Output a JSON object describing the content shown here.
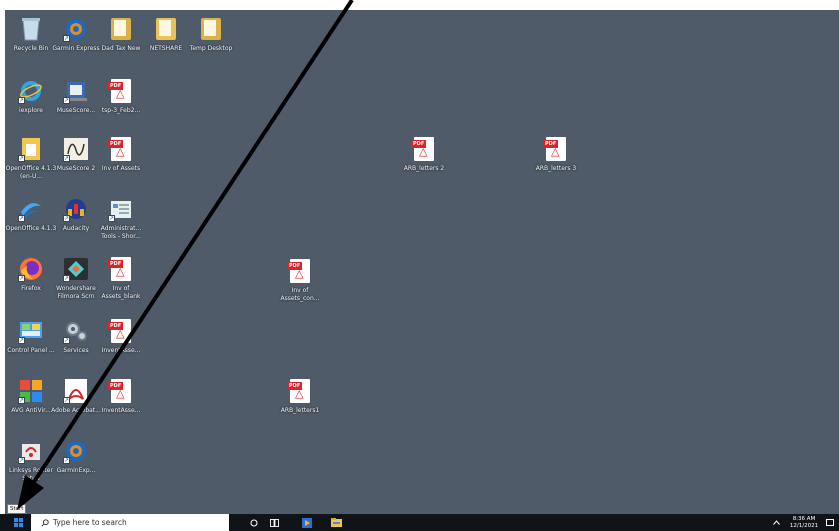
{
  "desktop": {
    "icons": [
      {
        "id": "recycle-bin",
        "label": "Recycle Bin",
        "icon": "recycle-bin-icon",
        "type": "recycle"
      },
      {
        "id": "garmin-express",
        "label": "Garmin Express",
        "icon": "garmin-icon",
        "type": "garmin"
      },
      {
        "id": "dad-tax-new",
        "label": "Dad Tax New",
        "icon": "document-icon",
        "type": "doc"
      },
      {
        "id": "netshare",
        "label": "NETSHARE",
        "icon": "folder-icon",
        "type": "folder"
      },
      {
        "id": "temp-desktop",
        "label": "Temp Desktop",
        "icon": "document-icon",
        "type": "doc"
      },
      {
        "id": "iexplore",
        "label": "iexplore",
        "icon": "internet-explorer-icon",
        "type": "ie"
      },
      {
        "id": "musescore-1",
        "label": "MuseScore...",
        "icon": "musescore-icon",
        "type": "muse1"
      },
      {
        "id": "tsp",
        "label": "tsp-3_Feb2...",
        "icon": "pdf-icon",
        "type": "pdf"
      },
      {
        "id": "openoffice-en",
        "label": "OpenOffice 4.1.3 (en-U...",
        "icon": "openoffice-icon",
        "type": "oo"
      },
      {
        "id": "musescore-2",
        "label": "MuseScore 2",
        "icon": "musescore-icon",
        "type": "muse2"
      },
      {
        "id": "inv-of-assets",
        "label": "Inv of Assets",
        "icon": "pdf-icon",
        "type": "pdf"
      },
      {
        "id": "arb-letters-2",
        "label": "ARB_letters 2",
        "icon": "pdf-icon",
        "type": "pdf"
      },
      {
        "id": "arb-letters-3",
        "label": "ARB_letters 3",
        "icon": "pdf-icon",
        "type": "pdf"
      },
      {
        "id": "openoffice",
        "label": "OpenOffice 4.1.3",
        "icon": "openoffice-icon",
        "type": "oo2"
      },
      {
        "id": "audacity",
        "label": "Audacity",
        "icon": "audacity-icon",
        "type": "audacity"
      },
      {
        "id": "admin-tools",
        "label": "Administrat... Tools - Shor...",
        "icon": "admin-tools-icon",
        "type": "admin"
      },
      {
        "id": "firefox",
        "label": "Firefox",
        "icon": "firefox-icon",
        "type": "firefox"
      },
      {
        "id": "filmora",
        "label": "Wondershare Filmora Scrn",
        "icon": "filmora-icon",
        "type": "filmora"
      },
      {
        "id": "inv-blank",
        "label": "Inv of Assets_blank",
        "icon": "pdf-icon",
        "type": "pdf"
      },
      {
        "id": "inv-con",
        "label": "Inv of Assets_con...",
        "icon": "pdf-icon",
        "type": "pdf"
      },
      {
        "id": "control-panel",
        "label": "Control Panel ...",
        "icon": "control-panel-icon",
        "type": "cp"
      },
      {
        "id": "services",
        "label": "Services",
        "icon": "gears-icon",
        "type": "services"
      },
      {
        "id": "invent-1",
        "label": "InventAsse...",
        "icon": "pdf-icon",
        "type": "pdf"
      },
      {
        "id": "avg",
        "label": "AVG AntiVir...",
        "icon": "avg-icon",
        "type": "avg"
      },
      {
        "id": "acrobat",
        "label": "Adobe Acrobat...",
        "icon": "acrobat-icon",
        "type": "acrobat"
      },
      {
        "id": "invent-2",
        "label": "InventAsse...",
        "icon": "pdf-icon",
        "type": "pdf"
      },
      {
        "id": "arb-letters-1",
        "label": "ARB_letters1",
        "icon": "pdf-icon",
        "type": "pdf"
      },
      {
        "id": "linksys",
        "label": "Linksys Router Setup",
        "icon": "router-icon",
        "type": "linksys"
      },
      {
        "id": "garmin-exp",
        "label": "GarminExp...",
        "icon": "garmin-icon",
        "type": "garmin"
      }
    ]
  },
  "start_tooltip": "Start",
  "taskbar": {
    "search_placeholder": "Type here to search",
    "time": "8:36 AM",
    "date": "12/1/2021"
  },
  "colors": {
    "desktop": "#4f5b69",
    "taskbar": "#101418",
    "pdf_red": "#d6262c",
    "arrow": "#000000"
  }
}
